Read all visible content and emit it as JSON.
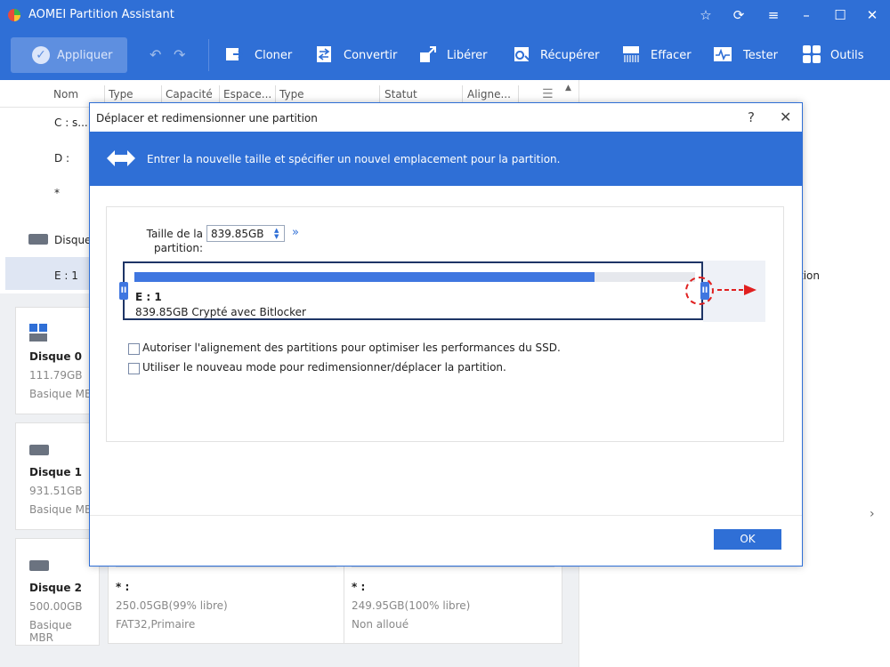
{
  "window": {
    "title": "AOMEI Partition Assistant",
    "controls": [
      "star-icon",
      "refresh-icon",
      "menu-icon",
      "minimize-icon",
      "maximize-icon",
      "close-icon"
    ]
  },
  "toolbar": {
    "apply_label": "Appliquer",
    "tools": [
      {
        "label": "Cloner",
        "icon": "clone-icon"
      },
      {
        "label": "Convertir",
        "icon": "convert-icon"
      },
      {
        "label": "Libérer",
        "icon": "free-up-icon"
      },
      {
        "label": "Récupérer",
        "icon": "recover-icon"
      },
      {
        "label": "Effacer",
        "icon": "wipe-icon"
      },
      {
        "label": "Tester",
        "icon": "test-icon"
      },
      {
        "label": "Outils",
        "icon": "tools-icon"
      }
    ]
  },
  "table": {
    "headers": [
      "Nom",
      "Type",
      "Capacité",
      "Espace...",
      "Type",
      "Statut",
      "Aligne..."
    ],
    "rows": [
      "C : s...",
      "D :",
      "*",
      "Disque",
      "E : 1"
    ]
  },
  "disks": [
    {
      "name": "Disque 0",
      "size": "111.79GB",
      "type": "Basique MB"
    },
    {
      "name": "Disque 1",
      "size": "931.51GB",
      "type": "Basique MB"
    },
    {
      "name": "Disque 2",
      "size": "500.00GB",
      "type": "Basique MBR"
    }
  ],
  "partitions_disk2": [
    {
      "name": "* :",
      "size": "250.05GB(99% libre)",
      "fs": "FAT32,Primaire"
    },
    {
      "name": "* :",
      "size": "249.95GB(100% libre)",
      "fs": "Non alloué"
    }
  ],
  "right_panel": {
    "fragment": "tion"
  },
  "dialog": {
    "title": "Déplacer et redimensionner une partition",
    "banner": "Entrer la nouvelle taille et spécifier un nouvel emplacement pour la partition.",
    "size_label": "Taille de la partition:",
    "size_value": "839.85GB",
    "partition": {
      "name": "E : 1",
      "info": "839.85GB Crypté avec Bitlocker",
      "fill_fraction": 0.82
    },
    "options": [
      "Autoriser l'alignement des partitions pour optimiser les performances du SSD.",
      "Utiliser le nouveau mode pour redimensionner/déplacer la partition."
    ],
    "ok_label": "OK"
  },
  "colors": {
    "accent": "#2f6fd6",
    "fill": "#3f76e0",
    "annotation": "#e02020"
  }
}
